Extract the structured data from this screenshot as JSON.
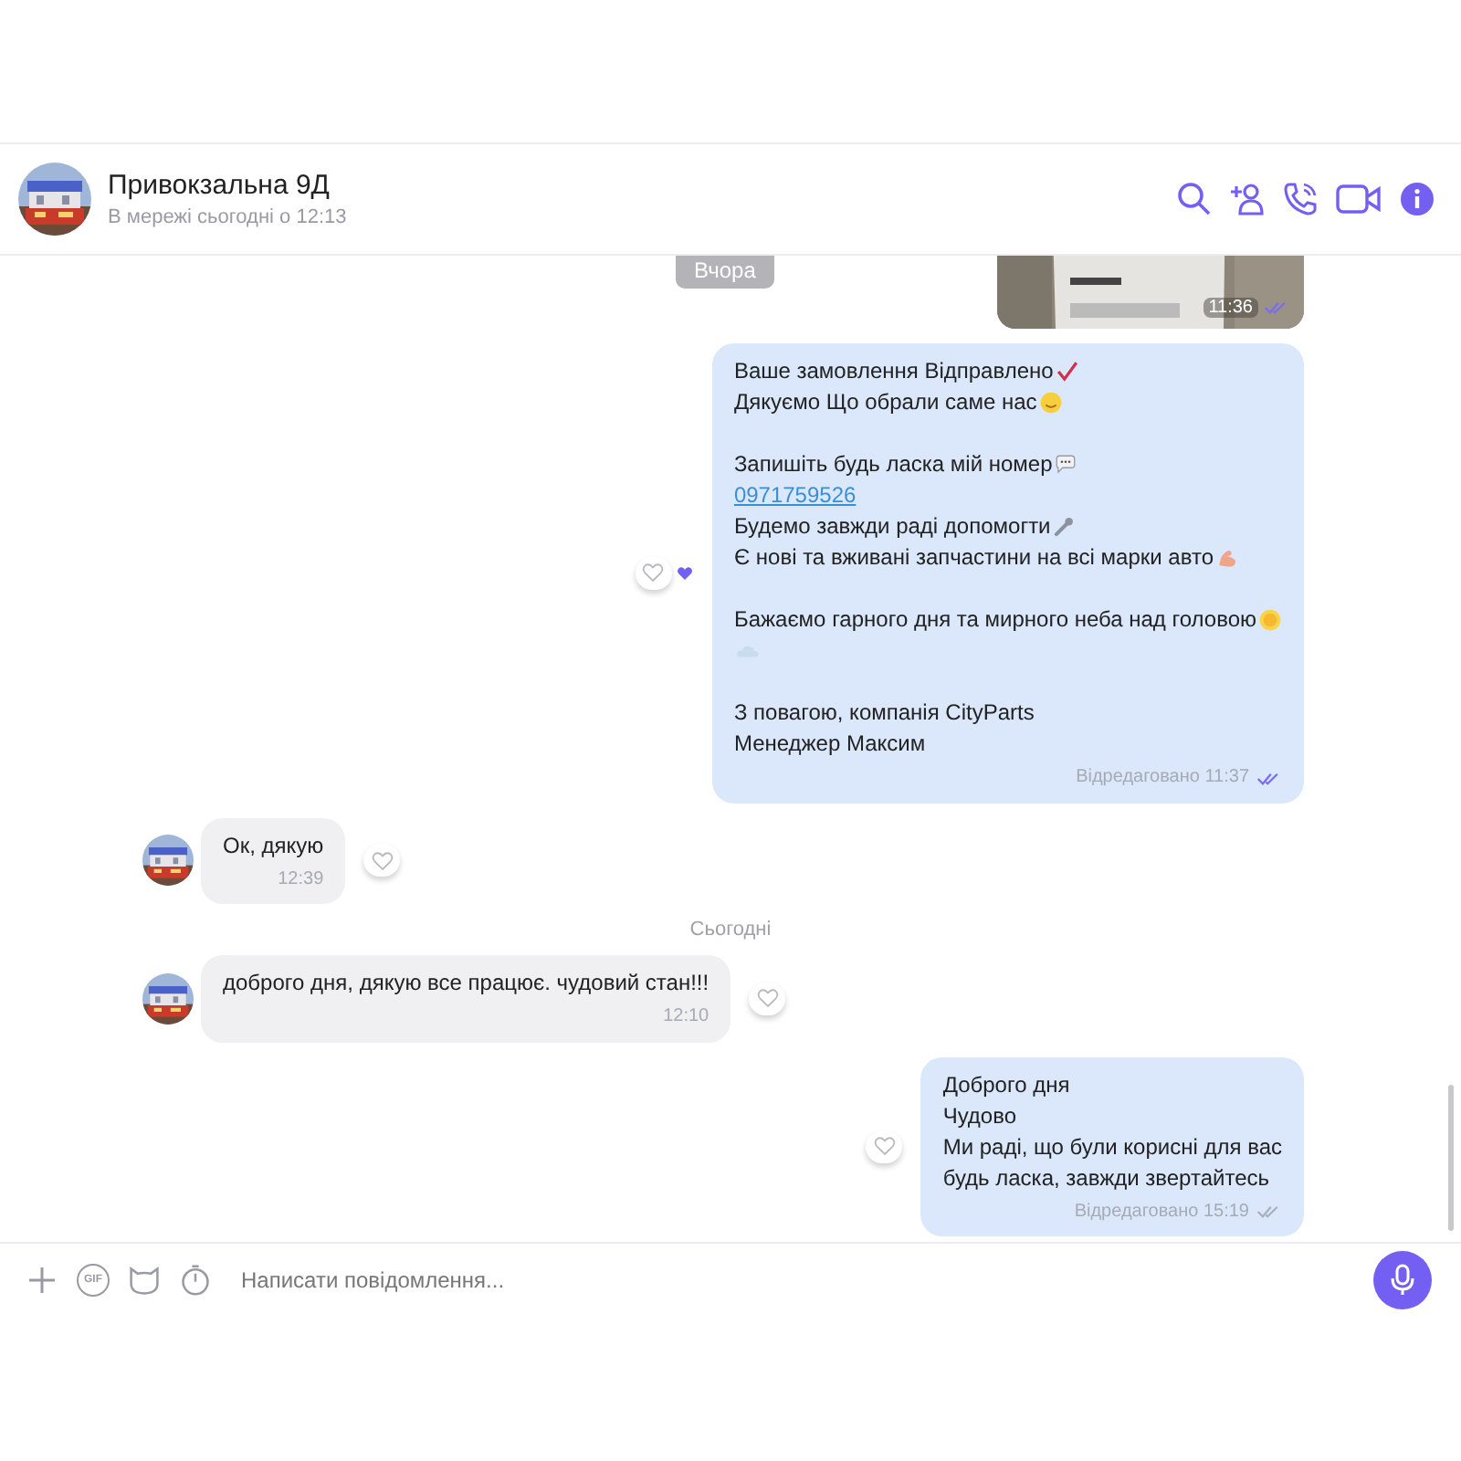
{
  "header": {
    "title": "Привокзальна 9Д",
    "status": "В мережі сьогодні о 12:13"
  },
  "date_badge": "Вчора",
  "messages": [
    {
      "outgoing": true,
      "meta": "11:36",
      "read": true
    },
    {
      "kind": "text",
      "outgoing": true,
      "meta": "Відредаговано 11:37",
      "read": true,
      "reaction": {
        "liked": true
      },
      "paragraphs": [
        [
          {
            "text": "Ваше замовлення Відправлено",
            "icon": {
              "kind": "check"
            }
          },
          {
            "text": "Дякуємо Що обрали саме нас",
            "icon": {
              "kind": "smiley"
            }
          }
        ],
        [
          {
            "text": "Запишіть будь ласка мій номер",
            "icon": {
              "kind": "speech"
            }
          },
          {
            "text": "0971759526",
            "kind": "link"
          },
          {
            "text": "Будемо завжди раді допомогти",
            "icon": {
              "kind": "wrench"
            }
          },
          {
            "text": "Є нові та вживані запчастини на всі марки авто",
            "icon": {
              "kind": "arm"
            }
          }
        ],
        [
          {
            "text": "Бажаємо гарного дня та мирного неба над головою",
            "icon": {
              "kind": "sun"
            }
          },
          {
            "icon": {
              "kind": "cloud"
            }
          }
        ],
        [
          {
            "text": "З повагою, компанія CityParts"
          },
          {
            "text": "Менеджер Максим"
          }
        ]
      ]
    },
    {
      "kind": "text",
      "outgoing": false,
      "meta": "12:39",
      "reaction": {
        "liked": false
      },
      "paragraphs": [
        [
          {
            "text": "Ок, дякую"
          }
        ]
      ]
    },
    {
      "kind": "divider",
      "label": "Сьогодні"
    },
    {
      "kind": "text",
      "outgoing": false,
      "meta": "12:10",
      "reaction": {
        "liked": false
      },
      "paragraphs": [
        [
          {
            "text": "доброго дня, дякую все працює. чудовий стан!!!"
          }
        ]
      ]
    },
    {
      "kind": "text",
      "outgoing": true,
      "meta": "Відредаговано 15:19",
      "read": false,
      "reaction": {
        "liked": false
      },
      "paragraphs": [
        [
          {
            "text": "Доброго дня"
          },
          {
            "text": "Чудово"
          },
          {
            "text": "Ми раді, що були корисні для вас"
          },
          {
            "text": "будь ласка, завжди звертайтесь"
          }
        ]
      ]
    }
  ],
  "composer": {
    "gif_label": "GIF",
    "placeholder": "Написати повідомлення..."
  }
}
